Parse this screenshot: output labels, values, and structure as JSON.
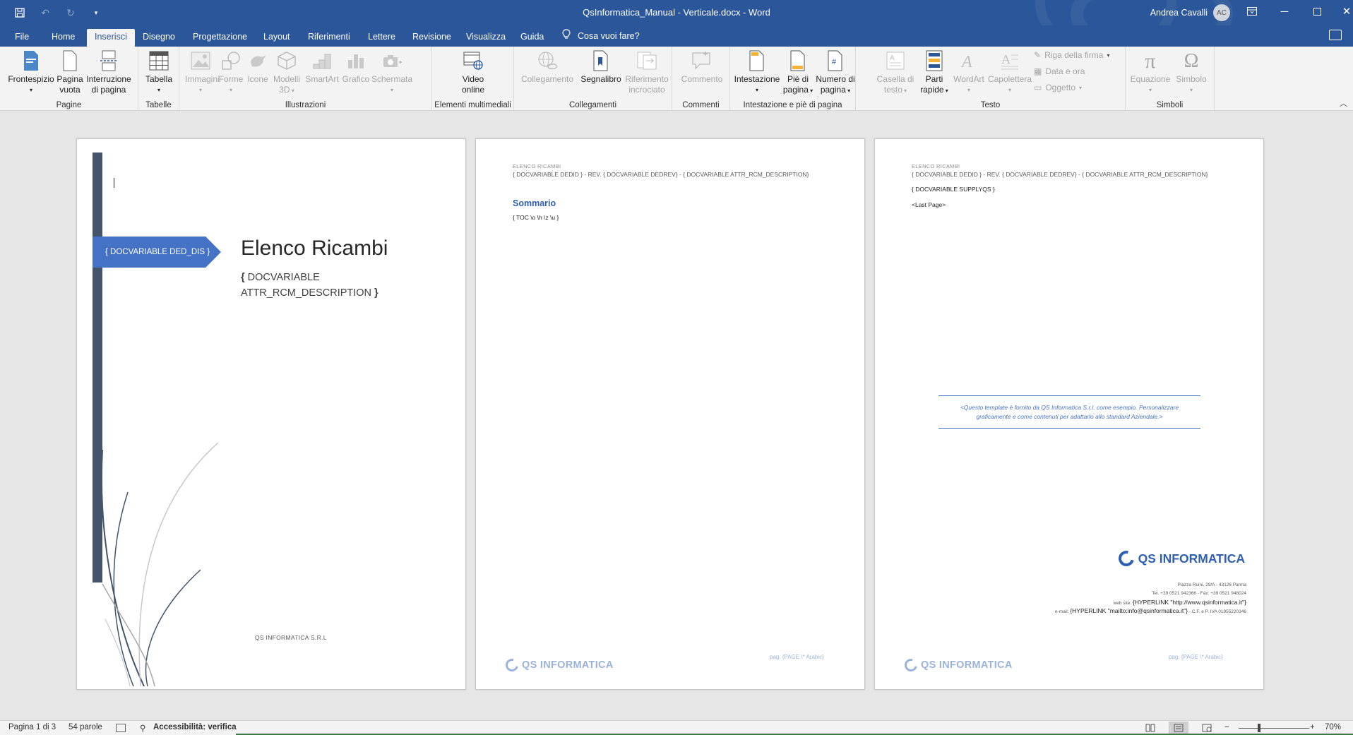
{
  "titlebar": {
    "title": "QsInformatica_Manual - Verticale.docx  -  Word",
    "user_name": "Andrea Cavalli",
    "user_initials": "AC"
  },
  "tabs": [
    "File",
    "Home",
    "Inserisci",
    "Disegno",
    "Progettazione",
    "Layout",
    "Riferimenti",
    "Lettere",
    "Revisione",
    "Visualizza",
    "Guida"
  ],
  "active_tab": "Inserisci",
  "tell_me": "Cosa vuoi fare?",
  "ribbon": {
    "groups": {
      "pagine": "Pagine",
      "tabelle": "Tabelle",
      "illustrazioni": "Illustrazioni",
      "multimedia": "Elementi multimediali",
      "collegamenti": "Collegamenti",
      "commenti": "Commenti",
      "intestazione": "Intestazione e piè di pagina",
      "testo": "Testo",
      "simboli": "Simboli"
    },
    "buttons": {
      "frontespizio": "Frontespizio",
      "pagina_vuota_1": "Pagina",
      "pagina_vuota_2": "vuota",
      "interruzione_1": "Interruzione",
      "interruzione_2": "di pagina",
      "tabella": "Tabella",
      "immagini": "Immagini",
      "forme": "Forme",
      "icone": "Icone",
      "modelli_1": "Modelli",
      "modelli_2": "3D",
      "smartart": "SmartArt",
      "grafico": "Grafico",
      "schermata": "Schermata",
      "video_1": "Video",
      "video_2": "online",
      "collegamento": "Collegamento",
      "segnalibro": "Segnalibro",
      "riferimento_1": "Riferimento",
      "riferimento_2": "incrociato",
      "commento": "Commento",
      "intestazione": "Intestazione",
      "piede_1": "Piè di",
      "piede_2": "pagina",
      "numero_1": "Numero di",
      "numero_2": "pagina",
      "casella_1": "Casella di",
      "casella_2": "testo",
      "parti_1": "Parti",
      "parti_2": "rapide",
      "wordart": "WordArt",
      "capolettera": "Capolettera",
      "riga_firma": "Riga della firma",
      "data_ora": "Data e ora",
      "oggetto": "Oggetto",
      "equazione": "Equazione",
      "simbolo": "Simbolo"
    }
  },
  "page1": {
    "tag": "{ DOCVARIABLE  DED_DIS }",
    "title": "Elenco Ricambi",
    "subtitle_line1": "DOCVARIABLE",
    "subtitle_line2": "ATTR_RCM_DESCRIPTION",
    "company": "QS INFORMATICA S.R.L"
  },
  "page2": {
    "header_small": "ELENCO RICAMBI",
    "header_line": "{ DOCVARIABLE  DEDID  } - REV. { DOCVARIABLE  DEDREV} - { DOCVARIABLE  ATTR_RCM_DESCRIPTION}",
    "toc_title": "Sommario",
    "toc_field": "{ TOC \\o \\h \\z \\u }",
    "footer_logo": "QS INFORMATICA",
    "footer_page": "pag. {PAGE  \\* Arabic}"
  },
  "page3": {
    "header_small": "ELENCO RICAMBI",
    "header_line": "{ DOCVARIABLE  DEDID  } - REV. { DOCVARIABLE  DEDREV} - { DOCVARIABLE  ATTR_RCM_DESCRIPTION}",
    "supply_field": "{ DOCVARIABLE  SUPPLYQS }",
    "last_page": "<Last Page>",
    "note": "<Questo template è fornito da QS Informatica S.r.l. come esempio. Personalizzare graficamente e come contenuti per adattarlo allo standard Aziendale.>",
    "brand": "QS INFORMATICA",
    "address": "Piazza Ruini, 29/A - 43126 Parma",
    "phone": "Tel. +39 0521 942366 - Fax: +39 0521 948024",
    "web_prefix": "web site:",
    "web_link": "{HYPERLINK \"http://www.qsinformatica.it\"}",
    "email_prefix": "e-mail:",
    "email_link": "{HYPERLINK \"mailto:info@qsinformatica.it\"}",
    "vat": " - C.F. e P. IVA 01955220346",
    "footer_logo": "QS INFORMATICA",
    "footer_page": "pag. {PAGE  \\* Arabic}"
  },
  "statusbar": {
    "page": "Pagina 1 di 3",
    "words": "54 parole",
    "accessibility": "Accessibilità: verifica",
    "zoom": "70%",
    "zoom_out": "−",
    "zoom_in": "+"
  },
  "colors": {
    "word_blue": "#2b579a",
    "accent": "#4472c4",
    "sidebar": "#44546a"
  }
}
